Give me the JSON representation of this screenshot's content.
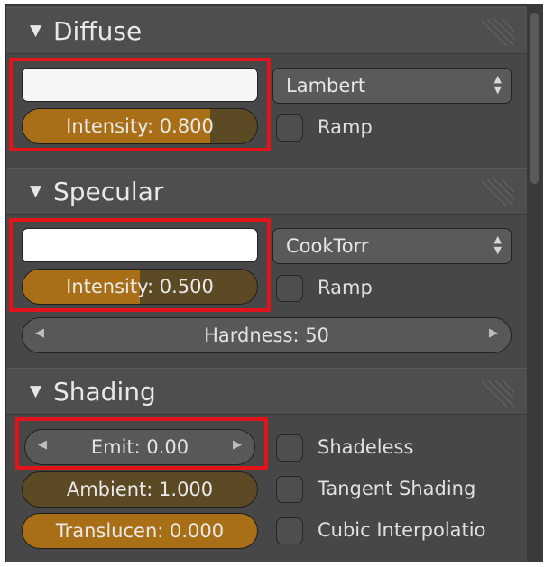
{
  "diffuse": {
    "title": "Diffuse",
    "shader": "Lambert",
    "intensity_label": "Intensity: 0.800",
    "intensity_value": 0.8,
    "ramp_label": "Ramp",
    "color": "#f6f6f6"
  },
  "specular": {
    "title": "Specular",
    "shader": "CookTorr",
    "intensity_label": "Intensity: 0.500",
    "intensity_value": 0.5,
    "ramp_label": "Ramp",
    "hardness_label": "Hardness: 50",
    "color": "#ffffff"
  },
  "shading": {
    "title": "Shading",
    "emit_label": "Emit: 0.00",
    "ambient_label": "Ambient: 1.000",
    "ambient_value": 1.0,
    "translucency_label": "Translucen: 0.000",
    "translucency_value": 0.0,
    "shadeless_label": "Shadeless",
    "tangent_label": "Tangent Shading",
    "cubic_label": "Cubic Interpolatio"
  },
  "colors": {
    "highlight": "#e1141b",
    "slider_fill": "#a96f17",
    "slider_bg": "#5b4a24"
  }
}
